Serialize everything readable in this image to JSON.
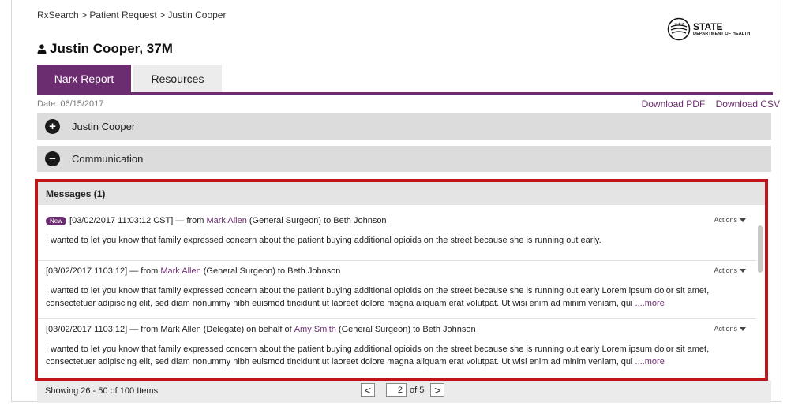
{
  "breadcrumb": "RxSearch > Patient Request > Justin Cooper",
  "logo": {
    "title": "STATE",
    "subtitle": "DEPARTMENT OF HEALTH"
  },
  "patient": {
    "name": "Justin Cooper, 37M",
    "icon": "person-icon"
  },
  "tabs": [
    {
      "label": "Narx Report",
      "active": true
    },
    {
      "label": "Resources",
      "active": false
    }
  ],
  "date": "Date: 06/15/2017",
  "downloads": {
    "pdf": "Download PDF",
    "csv": "Download CSV"
  },
  "accordions": [
    {
      "label": "Justin Cooper",
      "icon": "plus-icon",
      "symbol": "+"
    },
    {
      "label": "Communication",
      "icon": "minus-icon",
      "symbol": "−"
    }
  ],
  "messages": {
    "header": "Messages (1)",
    "actions_label": "Actions",
    "more_label": "....more",
    "items": [
      {
        "badge": "New",
        "timestamp": "[03/02/2017 11:03:12 CST]",
        "from_prefix": " — from ",
        "sender": "Mark Allen",
        "sender_role": " (General Surgeon) to Beth Johnson",
        "body": "I wanted to let you know that family expressed concern about the patient buying additional opioids on the street because she is running out early."
      },
      {
        "timestamp": "[03/02/2017 1103:12]",
        "from_prefix": " — from ",
        "sender": "Mark Allen",
        "sender_role": " (General Surgeon) to Beth Johnson",
        "body": "I wanted to let you know that family expressed concern about the patient buying additional opioids on the street because she is running out early Lorem ipsum dolor sit amet, consectetuer adipiscing elit, sed diam nonummy nibh euismod tincidunt ut laoreet dolore magna aliquam erat volutpat. Ut wisi enim ad minim veniam, qui "
      },
      {
        "timestamp": "[03/02/2017 1103:12]",
        "from_prefix": " — from Mark Allen (Delegate) on behalf of ",
        "sender": "Amy Smith",
        "sender_role": " (General Surgeon) to Beth Johnson",
        "body": "I wanted to let you know that family expressed concern about the patient buying additional opioids on the street because she is running out early Lorem ipsum dolor sit amet, consectetuer adipiscing elit, sed diam nonummy nibh euismod tincidunt ut laoreet dolore magna aliquam erat volutpat. Ut wisi enim ad minim veniam, qui "
      }
    ]
  },
  "pagination": {
    "showing": "Showing 26 - 50 of 100 Items",
    "prev": "<",
    "page": "2",
    "of_total": "of 5",
    "next": ">"
  },
  "colors": {
    "brand": "#6b2d6f",
    "highlight": "#c0141b"
  }
}
